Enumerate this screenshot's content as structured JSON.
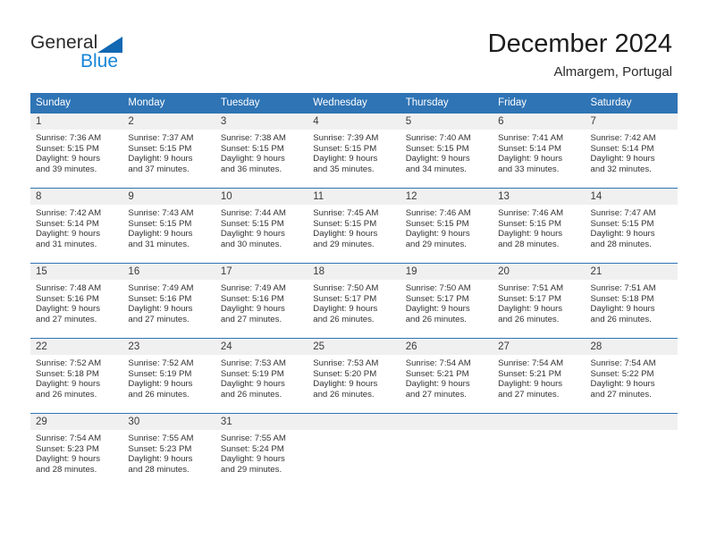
{
  "brand": {
    "name_part1": "General",
    "name_part2": "Blue",
    "triangle_color": "#1268b3",
    "blue_color": "#1686d8"
  },
  "header": {
    "title": "December 2024",
    "subtitle": "Almargem, Portugal"
  },
  "theme": {
    "header_blue": "#2f74b5",
    "daynum_gray": "#f0f0f0",
    "text": "#333333"
  },
  "calendar": {
    "weekday_headers": [
      "Sunday",
      "Monday",
      "Tuesday",
      "Wednesday",
      "Thursday",
      "Friday",
      "Saturday"
    ],
    "labels": {
      "sunrise": "Sunrise:",
      "sunset": "Sunset:",
      "daylight": "Daylight:"
    },
    "weeks": [
      [
        {
          "day": "1",
          "sunrise": "Sunrise: 7:36 AM",
          "sunset": "Sunset: 5:15 PM",
          "daylight_line1": "Daylight: 9 hours",
          "daylight_line2": "and 39 minutes."
        },
        {
          "day": "2",
          "sunrise": "Sunrise: 7:37 AM",
          "sunset": "Sunset: 5:15 PM",
          "daylight_line1": "Daylight: 9 hours",
          "daylight_line2": "and 37 minutes."
        },
        {
          "day": "3",
          "sunrise": "Sunrise: 7:38 AM",
          "sunset": "Sunset: 5:15 PM",
          "daylight_line1": "Daylight: 9 hours",
          "daylight_line2": "and 36 minutes."
        },
        {
          "day": "4",
          "sunrise": "Sunrise: 7:39 AM",
          "sunset": "Sunset: 5:15 PM",
          "daylight_line1": "Daylight: 9 hours",
          "daylight_line2": "and 35 minutes."
        },
        {
          "day": "5",
          "sunrise": "Sunrise: 7:40 AM",
          "sunset": "Sunset: 5:15 PM",
          "daylight_line1": "Daylight: 9 hours",
          "daylight_line2": "and 34 minutes."
        },
        {
          "day": "6",
          "sunrise": "Sunrise: 7:41 AM",
          "sunset": "Sunset: 5:14 PM",
          "daylight_line1": "Daylight: 9 hours",
          "daylight_line2": "and 33 minutes."
        },
        {
          "day": "7",
          "sunrise": "Sunrise: 7:42 AM",
          "sunset": "Sunset: 5:14 PM",
          "daylight_line1": "Daylight: 9 hours",
          "daylight_line2": "and 32 minutes."
        }
      ],
      [
        {
          "day": "8",
          "sunrise": "Sunrise: 7:42 AM",
          "sunset": "Sunset: 5:14 PM",
          "daylight_line1": "Daylight: 9 hours",
          "daylight_line2": "and 31 minutes."
        },
        {
          "day": "9",
          "sunrise": "Sunrise: 7:43 AM",
          "sunset": "Sunset: 5:15 PM",
          "daylight_line1": "Daylight: 9 hours",
          "daylight_line2": "and 31 minutes."
        },
        {
          "day": "10",
          "sunrise": "Sunrise: 7:44 AM",
          "sunset": "Sunset: 5:15 PM",
          "daylight_line1": "Daylight: 9 hours",
          "daylight_line2": "and 30 minutes."
        },
        {
          "day": "11",
          "sunrise": "Sunrise: 7:45 AM",
          "sunset": "Sunset: 5:15 PM",
          "daylight_line1": "Daylight: 9 hours",
          "daylight_line2": "and 29 minutes."
        },
        {
          "day": "12",
          "sunrise": "Sunrise: 7:46 AM",
          "sunset": "Sunset: 5:15 PM",
          "daylight_line1": "Daylight: 9 hours",
          "daylight_line2": "and 29 minutes."
        },
        {
          "day": "13",
          "sunrise": "Sunrise: 7:46 AM",
          "sunset": "Sunset: 5:15 PM",
          "daylight_line1": "Daylight: 9 hours",
          "daylight_line2": "and 28 minutes."
        },
        {
          "day": "14",
          "sunrise": "Sunrise: 7:47 AM",
          "sunset": "Sunset: 5:15 PM",
          "daylight_line1": "Daylight: 9 hours",
          "daylight_line2": "and 28 minutes."
        }
      ],
      [
        {
          "day": "15",
          "sunrise": "Sunrise: 7:48 AM",
          "sunset": "Sunset: 5:16 PM",
          "daylight_line1": "Daylight: 9 hours",
          "daylight_line2": "and 27 minutes."
        },
        {
          "day": "16",
          "sunrise": "Sunrise: 7:49 AM",
          "sunset": "Sunset: 5:16 PM",
          "daylight_line1": "Daylight: 9 hours",
          "daylight_line2": "and 27 minutes."
        },
        {
          "day": "17",
          "sunrise": "Sunrise: 7:49 AM",
          "sunset": "Sunset: 5:16 PM",
          "daylight_line1": "Daylight: 9 hours",
          "daylight_line2": "and 27 minutes."
        },
        {
          "day": "18",
          "sunrise": "Sunrise: 7:50 AM",
          "sunset": "Sunset: 5:17 PM",
          "daylight_line1": "Daylight: 9 hours",
          "daylight_line2": "and 26 minutes."
        },
        {
          "day": "19",
          "sunrise": "Sunrise: 7:50 AM",
          "sunset": "Sunset: 5:17 PM",
          "daylight_line1": "Daylight: 9 hours",
          "daylight_line2": "and 26 minutes."
        },
        {
          "day": "20",
          "sunrise": "Sunrise: 7:51 AM",
          "sunset": "Sunset: 5:17 PM",
          "daylight_line1": "Daylight: 9 hours",
          "daylight_line2": "and 26 minutes."
        },
        {
          "day": "21",
          "sunrise": "Sunrise: 7:51 AM",
          "sunset": "Sunset: 5:18 PM",
          "daylight_line1": "Daylight: 9 hours",
          "daylight_line2": "and 26 minutes."
        }
      ],
      [
        {
          "day": "22",
          "sunrise": "Sunrise: 7:52 AM",
          "sunset": "Sunset: 5:18 PM",
          "daylight_line1": "Daylight: 9 hours",
          "daylight_line2": "and 26 minutes."
        },
        {
          "day": "23",
          "sunrise": "Sunrise: 7:52 AM",
          "sunset": "Sunset: 5:19 PM",
          "daylight_line1": "Daylight: 9 hours",
          "daylight_line2": "and 26 minutes."
        },
        {
          "day": "24",
          "sunrise": "Sunrise: 7:53 AM",
          "sunset": "Sunset: 5:19 PM",
          "daylight_line1": "Daylight: 9 hours",
          "daylight_line2": "and 26 minutes."
        },
        {
          "day": "25",
          "sunrise": "Sunrise: 7:53 AM",
          "sunset": "Sunset: 5:20 PM",
          "daylight_line1": "Daylight: 9 hours",
          "daylight_line2": "and 26 minutes."
        },
        {
          "day": "26",
          "sunrise": "Sunrise: 7:54 AM",
          "sunset": "Sunset: 5:21 PM",
          "daylight_line1": "Daylight: 9 hours",
          "daylight_line2": "and 27 minutes."
        },
        {
          "day": "27",
          "sunrise": "Sunrise: 7:54 AM",
          "sunset": "Sunset: 5:21 PM",
          "daylight_line1": "Daylight: 9 hours",
          "daylight_line2": "and 27 minutes."
        },
        {
          "day": "28",
          "sunrise": "Sunrise: 7:54 AM",
          "sunset": "Sunset: 5:22 PM",
          "daylight_line1": "Daylight: 9 hours",
          "daylight_line2": "and 27 minutes."
        }
      ],
      [
        {
          "day": "29",
          "sunrise": "Sunrise: 7:54 AM",
          "sunset": "Sunset: 5:23 PM",
          "daylight_line1": "Daylight: 9 hours",
          "daylight_line2": "and 28 minutes."
        },
        {
          "day": "30",
          "sunrise": "Sunrise: 7:55 AM",
          "sunset": "Sunset: 5:23 PM",
          "daylight_line1": "Daylight: 9 hours",
          "daylight_line2": "and 28 minutes."
        },
        {
          "day": "31",
          "sunrise": "Sunrise: 7:55 AM",
          "sunset": "Sunset: 5:24 PM",
          "daylight_line1": "Daylight: 9 hours",
          "daylight_line2": "and 29 minutes."
        },
        {
          "day": "",
          "sunrise": "",
          "sunset": "",
          "daylight_line1": "",
          "daylight_line2": ""
        },
        {
          "day": "",
          "sunrise": "",
          "sunset": "",
          "daylight_line1": "",
          "daylight_line2": ""
        },
        {
          "day": "",
          "sunrise": "",
          "sunset": "",
          "daylight_line1": "",
          "daylight_line2": ""
        },
        {
          "day": "",
          "sunrise": "",
          "sunset": "",
          "daylight_line1": "",
          "daylight_line2": ""
        }
      ]
    ]
  }
}
